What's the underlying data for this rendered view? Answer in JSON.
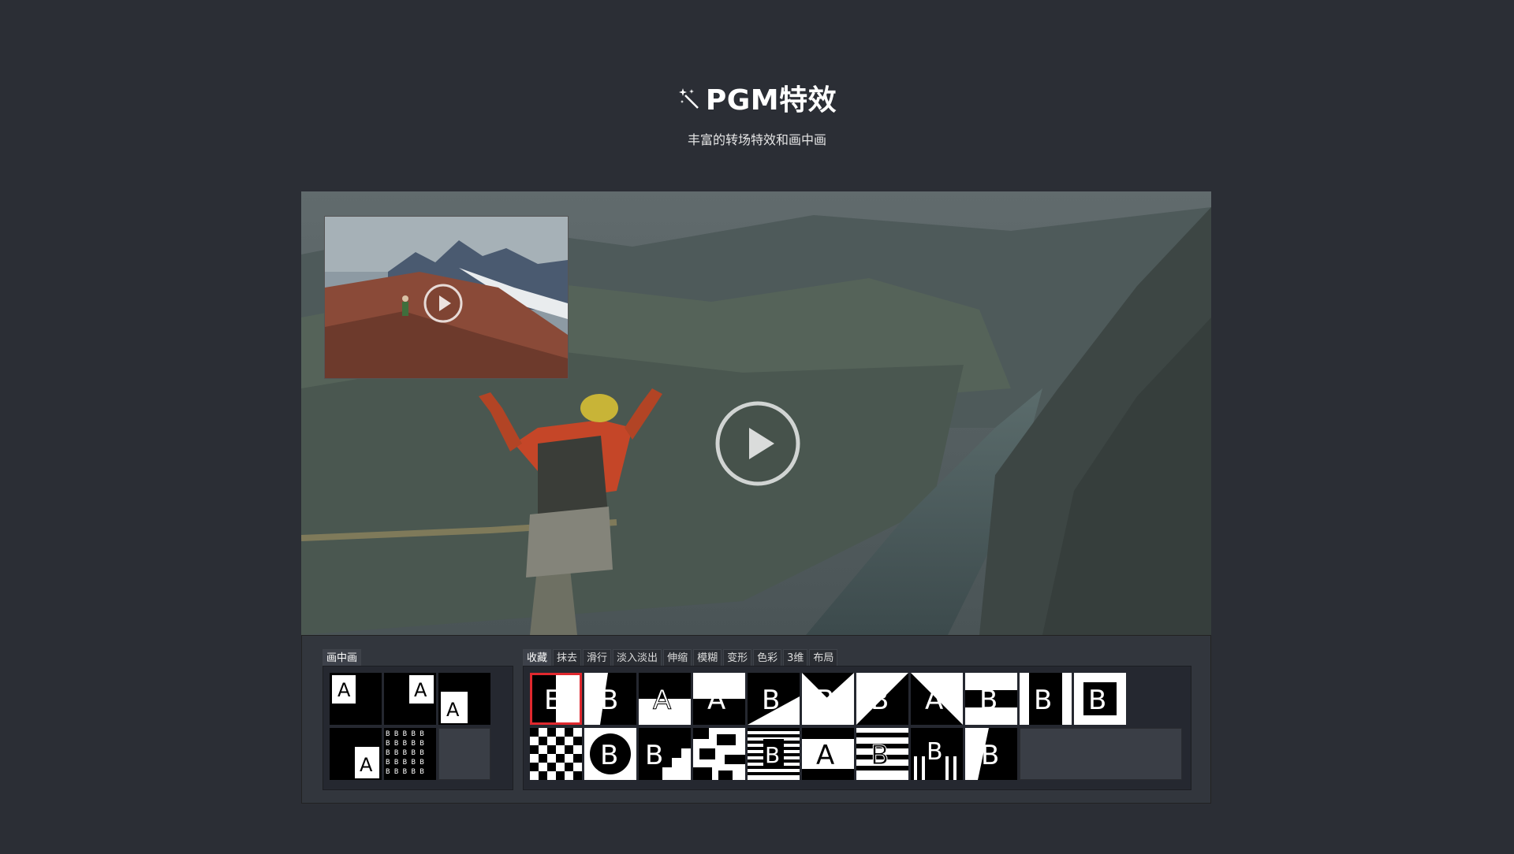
{
  "header": {
    "title": "PGM特效",
    "subtitle": "丰富的转场特效和画中画"
  },
  "icons": {
    "title_icon": "magic-wand-icon",
    "play": "play-icon"
  },
  "panel": {
    "pip_tab": "画中画",
    "effect_tabs": [
      "收藏",
      "抹去",
      "滑行",
      "淡入淡出",
      "伸缩",
      "模糊",
      "变形",
      "色彩",
      "3维",
      "布局"
    ],
    "active_effect_tab": "收藏"
  },
  "pip_items": [
    {
      "name": "pip-layout-top-left"
    },
    {
      "name": "pip-layout-top-right"
    },
    {
      "name": "pip-layout-bottom-right"
    },
    {
      "name": "pip-layout-bottom-left"
    },
    {
      "name": "pip-layout-grid"
    }
  ],
  "effect_items_row1": [
    "wipe-left-selected",
    "slide-fade",
    "wipe-horizontal",
    "wipe-diagonal",
    "wipe-corner",
    "wipe-triangle",
    "wipe-diagonal-split",
    "wipe-triangle-dark",
    "bars-horizontal",
    "bars-vertical",
    "box-zoom"
  ],
  "effect_items_row2": [
    "checker",
    "circle",
    "stairs",
    "blocks",
    "stripes-fine",
    "split-horizontal",
    "stripes-wide",
    "stripes-vertical",
    "slash"
  ],
  "colors": {
    "background": "#2b2e35",
    "selected": "#e0282e"
  }
}
